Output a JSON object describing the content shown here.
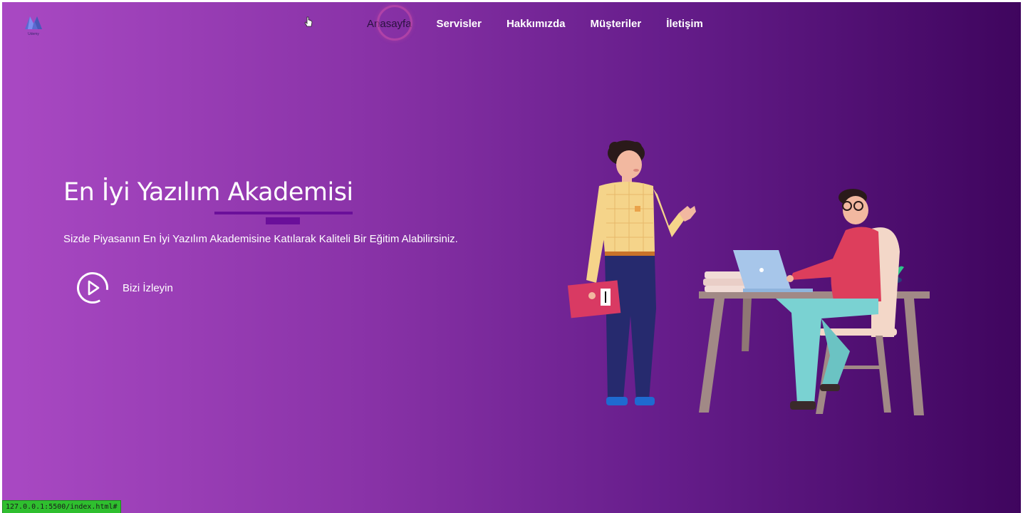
{
  "brand": {
    "logo_icon": "mountain-logo-icon",
    "logo_text": "Udemy"
  },
  "nav": {
    "items": [
      {
        "label": "Anasayfa",
        "active": true
      },
      {
        "label": "Servisler",
        "active": false
      },
      {
        "label": "Hakkımızda",
        "active": false
      },
      {
        "label": "Müşteriler",
        "active": false
      },
      {
        "label": "İletişim",
        "active": false
      }
    ]
  },
  "hero": {
    "title": "En İyi Yazılım Akademisi",
    "subtitle": "Sizde Piyasanın En İyi Yazılım Akademisine Katılarak Kaliteli Bir Eğitim Alabilirsiniz.",
    "cta_label": "Bizi İzleyin",
    "cta_icon": "play-circle-icon",
    "illustration": "office-people-illustration"
  },
  "status_bar": {
    "url": "127.0.0.1:5500/index.html#"
  },
  "colors": {
    "gradient_start": "#a949c3",
    "gradient_end": "#3f055e",
    "accent_line": "#6a0f9a",
    "status_green": "#2fbf2f"
  }
}
